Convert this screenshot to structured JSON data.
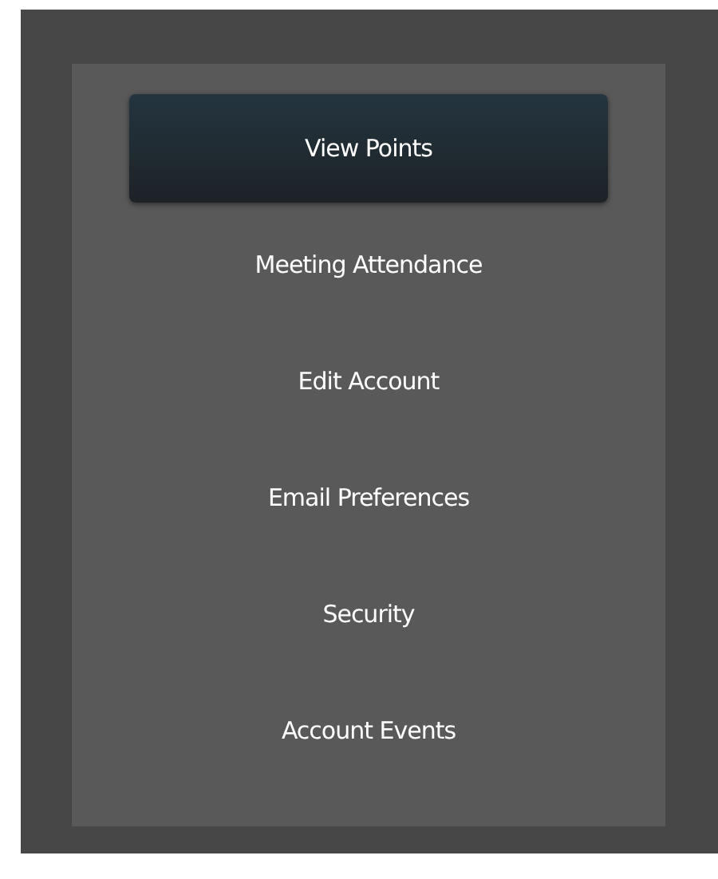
{
  "menu": [
    {
      "label": "View Points",
      "selected": true
    },
    {
      "label": "Meeting Attendance",
      "selected": false
    },
    {
      "label": "Edit Account",
      "selected": false
    },
    {
      "label": "Email Preferences",
      "selected": false
    },
    {
      "label": "Security",
      "selected": false
    },
    {
      "label": "Account Events",
      "selected": false
    }
  ]
}
